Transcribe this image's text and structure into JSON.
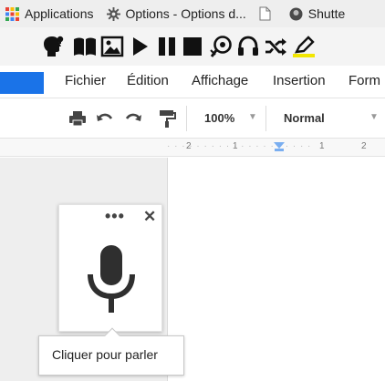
{
  "bookmarks": {
    "items": [
      {
        "label": "Applications",
        "icon": "apps-grid-icon"
      },
      {
        "label": "Options - Options d...",
        "icon": "gear-icon"
      },
      {
        "label": "",
        "icon": "blank-page-icon"
      },
      {
        "label": "Shutte",
        "icon": "shutterstock-icon"
      }
    ]
  },
  "extension_toolbar": {
    "icons": [
      "head-idea-icon",
      "book-icon",
      "image-icon",
      "play-icon",
      "pause-icon",
      "stop-icon",
      "voice-settings-icon",
      "headphones-icon",
      "shuffle-icon",
      "highlighter-icon"
    ],
    "highlight_color": "#f2e600"
  },
  "menu": {
    "items": [
      "Fichier",
      "Édition",
      "Affichage",
      "Insertion",
      "Form"
    ],
    "accent": "#1a73e8"
  },
  "format_toolbar": {
    "zoom": "100%",
    "style": "Normal"
  },
  "ruler": {
    "labels": [
      "2",
      "1",
      "1",
      "2"
    ]
  },
  "voice_typing": {
    "more": "•••",
    "close": "✕",
    "tooltip": "Cliquer pour parler"
  }
}
